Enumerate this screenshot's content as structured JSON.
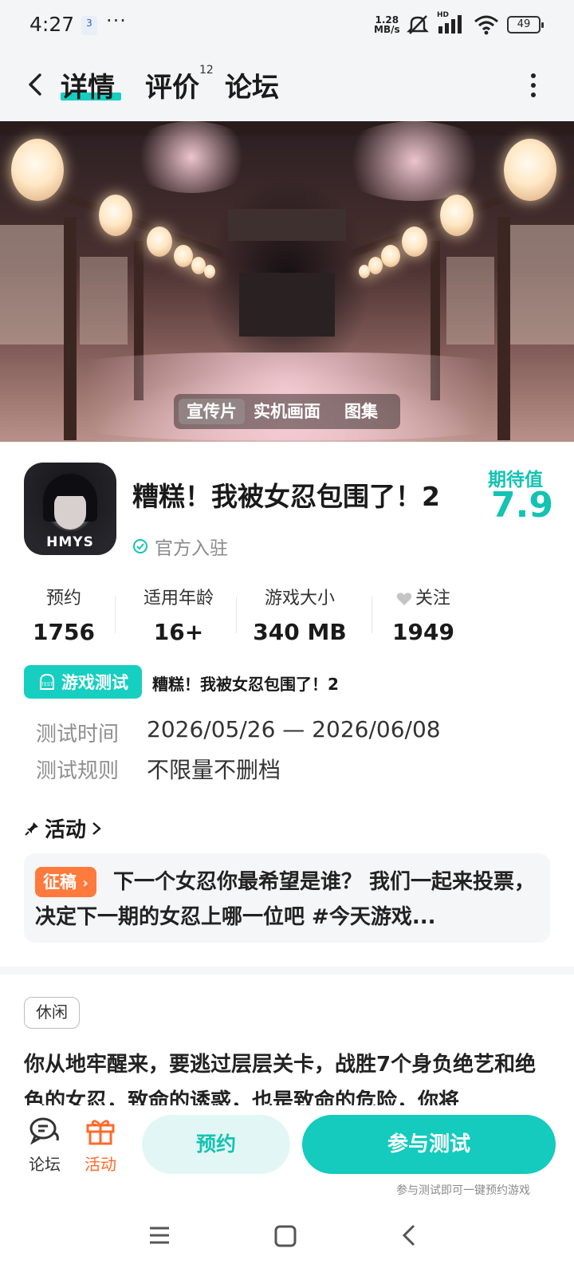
{
  "status_bar": {
    "time": "4:27",
    "app_icon_text": "3",
    "dots": "···",
    "net_speed_value": "1.28",
    "net_speed_unit": "MB/s",
    "signal_label": "HD",
    "battery": "49"
  },
  "header": {
    "tabs": [
      {
        "label": "详情",
        "active": true
      },
      {
        "label": "评价",
        "badge": "12"
      },
      {
        "label": "论坛"
      }
    ],
    "icons": {
      "back": "back-arrow-icon",
      "more": "more-vertical-icon"
    }
  },
  "banner": {
    "media_tabs": [
      {
        "label": "宣传片",
        "active": true
      },
      {
        "label": "实机画面"
      },
      {
        "label": "图集"
      }
    ]
  },
  "game": {
    "icon_label": "HMYS",
    "title": "糟糕！我被女忍包围了！2",
    "official_label": "官方入驻",
    "expectation_label": "期待值",
    "expectation_value": "7.9"
  },
  "stats": [
    {
      "label": "预约",
      "value": "1756"
    },
    {
      "label": "适用年龄",
      "value": "16+"
    },
    {
      "label": "游戏大小",
      "value": "340 MB"
    },
    {
      "label": "关注",
      "value": "1949",
      "icon": "heart-icon"
    }
  ],
  "test": {
    "badge_label": "游戏测试",
    "badge_icon_text": "TEST",
    "name": "糟糕！我被女忍包围了！2",
    "rows": [
      {
        "label": "测试时间",
        "value": "2026/05/26 — 2026/06/08"
      },
      {
        "label": "测试规则",
        "value": "不限量不删档"
      }
    ]
  },
  "activity": {
    "title": "活动",
    "tag": "征稿",
    "text": "下一个女忍你最希望是谁？ 我们一起来投票，决定下一期的女忍上哪一位吧 #今天游戏..."
  },
  "genre_tag": "休闲",
  "description": "你从地牢醒来，要逃过层层关卡，战胜7个身负绝艺和绝色的女忍，致命的诱惑，也是致命的危险，你将",
  "bottom_bar": {
    "forum_label": "论坛",
    "activity_label": "活动",
    "reserve_label": "预约",
    "join_label": "参与测试",
    "join_hint": "参与测试即可一键预约游戏",
    "colors": {
      "accent": "#14cbbd",
      "activity": "#ff6a2a"
    }
  }
}
